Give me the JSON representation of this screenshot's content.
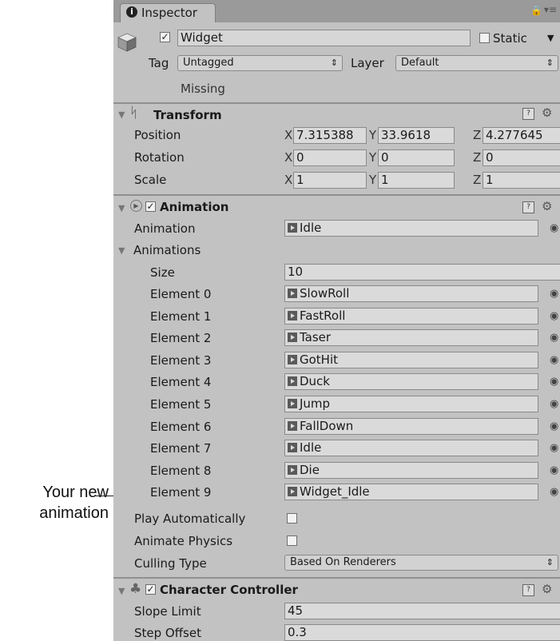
{
  "callout": {
    "line1": "Your new",
    "line2": "animation"
  },
  "tab": {
    "title": "Inspector",
    "info_icon": "info-icon"
  },
  "object": {
    "name": "Widget",
    "active": true,
    "static_label": "Static",
    "static": false,
    "tag_label": "Tag",
    "tag_value": "Untagged",
    "layer_label": "Layer",
    "layer_value": "Default",
    "missing_label": "Missing"
  },
  "transform": {
    "title": "Transform",
    "rows": [
      {
        "label": "Position",
        "x": "7.315388",
        "y": "33.9618",
        "z": "4.277645"
      },
      {
        "label": "Rotation",
        "x": "0",
        "y": "0",
        "z": "0"
      },
      {
        "label": "Scale",
        "x": "1",
        "y": "1",
        "z": "1"
      }
    ],
    "axis_x": "X",
    "axis_y": "Y",
    "axis_z": "Z"
  },
  "animation": {
    "title": "Animation",
    "enabled": true,
    "animation_label": "Animation",
    "animation_value": "Idle",
    "animations_label": "Animations",
    "size_label": "Size",
    "size_value": "10",
    "elements": [
      {
        "label": "Element 0",
        "value": "SlowRoll"
      },
      {
        "label": "Element 1",
        "value": "FastRoll"
      },
      {
        "label": "Element 2",
        "value": "Taser"
      },
      {
        "label": "Element 3",
        "value": "GotHit"
      },
      {
        "label": "Element 4",
        "value": "Duck"
      },
      {
        "label": "Element 5",
        "value": "Jump"
      },
      {
        "label": "Element 6",
        "value": "FallDown"
      },
      {
        "label": "Element 7",
        "value": "Idle"
      },
      {
        "label": "Element 8",
        "value": "Die"
      },
      {
        "label": "Element 9",
        "value": "Widget_Idle"
      }
    ],
    "play_auto_label": "Play Automatically",
    "play_auto": false,
    "animate_physics_label": "Animate Physics",
    "animate_physics": false,
    "culling_label": "Culling Type",
    "culling_value": "Based On Renderers"
  },
  "character_controller": {
    "title": "Character Controller",
    "enabled": true,
    "slope_label": "Slope Limit",
    "slope_value": "45",
    "step_label": "Step Offset",
    "step_value": "0.3"
  }
}
